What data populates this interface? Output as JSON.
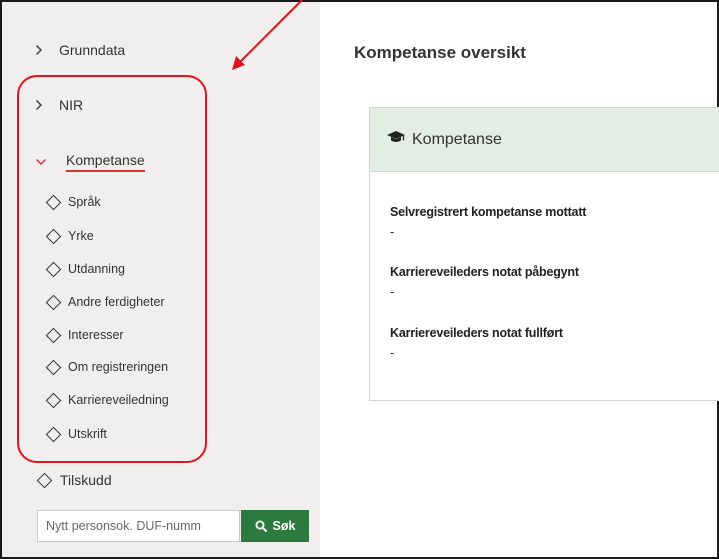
{
  "sidebar": {
    "top_items": [
      {
        "label": "Grunndata"
      },
      {
        "label": "NIR"
      }
    ],
    "expanded_item": {
      "label": "Kompetanse"
    },
    "sub_items": [
      {
        "label": "Språk"
      },
      {
        "label": "Yrke"
      },
      {
        "label": "Utdanning"
      },
      {
        "label": "Andre ferdigheter"
      },
      {
        "label": "Interesser"
      },
      {
        "label": "Om registreringen"
      },
      {
        "label": "Karriereveiledning"
      },
      {
        "label": "Utskrift"
      }
    ],
    "tilskudd_label": "Tilskudd",
    "search": {
      "placeholder": "Nytt personsok. DUF-numm",
      "button_label": "Søk"
    }
  },
  "main": {
    "title": "Kompetanse oversikt",
    "card": {
      "header": "Kompetanse",
      "fields": [
        {
          "label": "Selvregistrert kompetanse mottatt",
          "value": "-"
        },
        {
          "label": "Karriereveileders notat påbegynt",
          "value": "-"
        },
        {
          "label": "Karriereveileders notat fullført",
          "value": "-"
        }
      ]
    }
  },
  "colors": {
    "annotation": "#e0141c",
    "accent_green": "#2c7a3e",
    "card_header_bg": "#e4ede4",
    "sidebar_bg": "#f0efed"
  },
  "icons": {
    "collapsed": "chevron-right-icon",
    "expanded": "chevron-down-icon",
    "sub_item": "diamond-icon",
    "card_header": "graduation-cap-icon",
    "search": "search-icon"
  }
}
